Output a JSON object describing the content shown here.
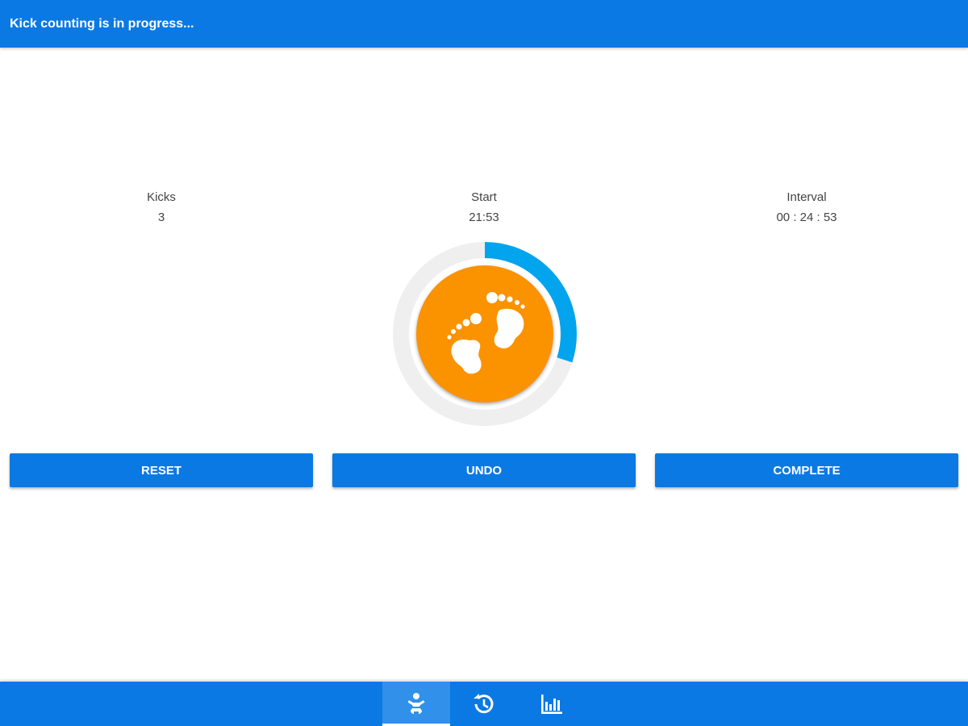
{
  "app_bar": {
    "title": "Kick counting is in progress..."
  },
  "stats": {
    "kicks": {
      "label": "Kicks",
      "value": "3"
    },
    "start": {
      "label": "Start",
      "value": "21:53"
    },
    "interval": {
      "label": "Interval",
      "value": "00 : 24 : 53"
    }
  },
  "progress": {
    "fraction": 0.3,
    "track_color": "#efefef",
    "fill_color": "#03a4ee"
  },
  "kick_button": {
    "icon": "baby-feet-icon",
    "color": "#fb9200"
  },
  "actions": {
    "reset_label": "RESET",
    "undo_label": "UNDO",
    "complete_label": "COMPLETE"
  },
  "bottom_nav": {
    "items": [
      {
        "icon": "baby-icon",
        "active": true
      },
      {
        "icon": "history-icon",
        "active": false
      },
      {
        "icon": "bar-chart-icon",
        "active": false
      }
    ]
  },
  "colors": {
    "primary": "#0a79e3",
    "accent": "#fb9200",
    "progress": "#03a4ee"
  }
}
